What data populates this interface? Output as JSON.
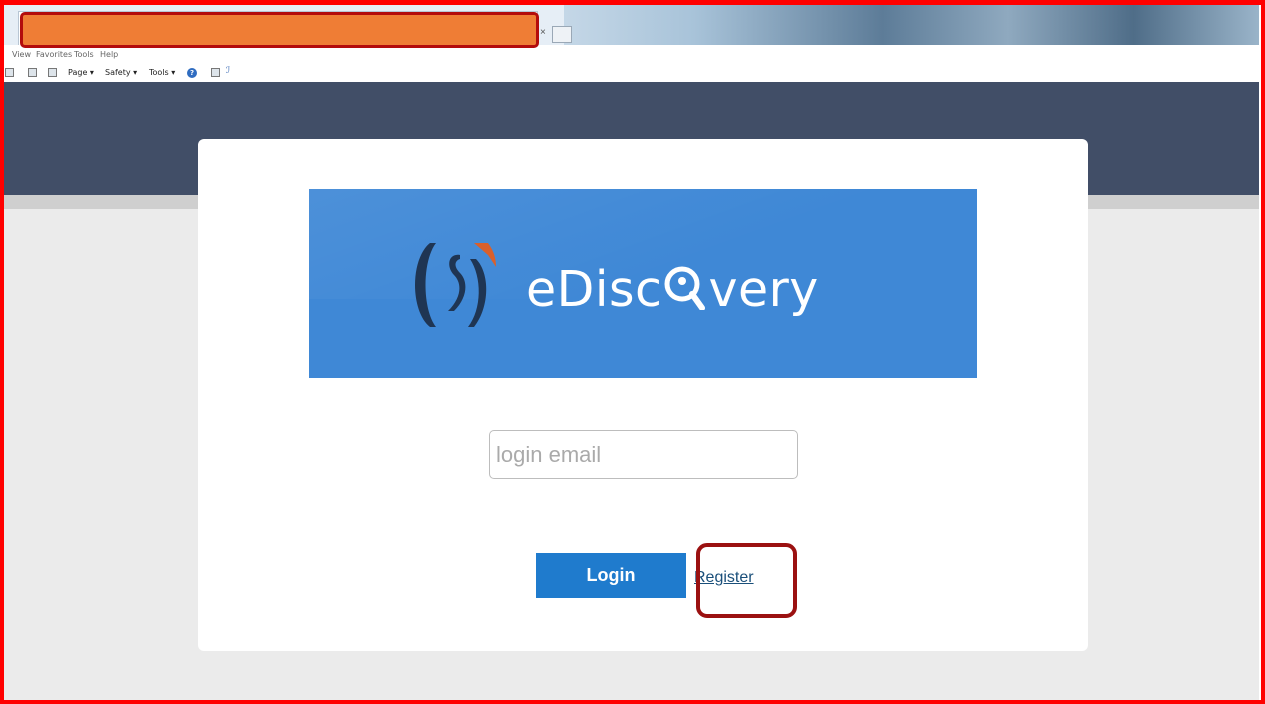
{
  "browser": {
    "menu": [
      "View",
      "Favorites",
      "Tools",
      "Help"
    ],
    "toolbar": {
      "page_label": "Page ▾",
      "safety_label": "Safety ▾",
      "tools_label": "Tools ▾"
    },
    "tab_close_glyph": "×"
  },
  "login": {
    "brand_text_pre": "eDisc",
    "brand_text_post": "very",
    "email_placeholder": "login email",
    "email_value": "",
    "login_button": "Login",
    "register_link": "Register"
  },
  "colors": {
    "header": "#414e67",
    "banner": "#3f88d6",
    "button": "#1f7bcd",
    "annotation_red": "#ff0000",
    "highlight_orange": "#ef7d35"
  }
}
